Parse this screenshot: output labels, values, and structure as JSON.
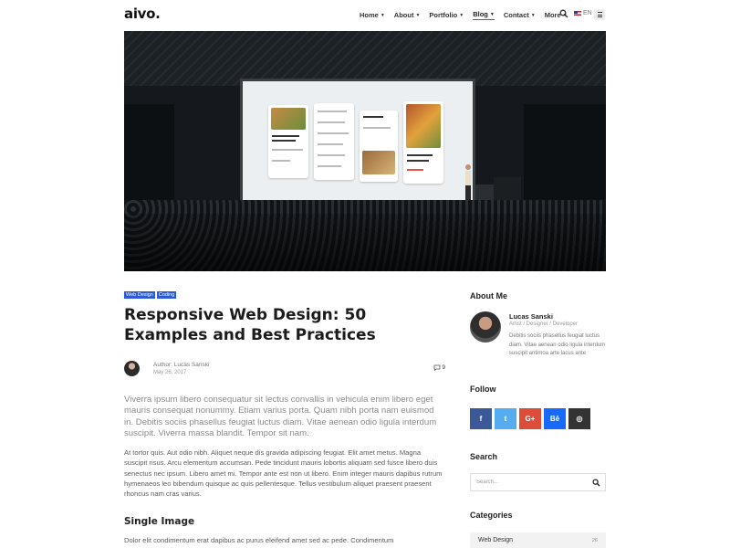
{
  "header": {
    "logo": "aivo.",
    "nav": [
      {
        "label": "Home",
        "active": false
      },
      {
        "label": "About",
        "active": false
      },
      {
        "label": "Portfolio",
        "active": false
      },
      {
        "label": "Blog",
        "active": true
      },
      {
        "label": "Contact",
        "active": false
      },
      {
        "label": "More",
        "active": false
      }
    ],
    "language": "EN",
    "accent_color": "#2b6cd6"
  },
  "hero": {
    "scene": "conference-stage-presentation"
  },
  "article": {
    "tags": [
      "Web Design",
      "Coding"
    ],
    "title": "Responsive Web Design: 50 Examples and Best Practices",
    "author": "Author: Lucas Sanski",
    "date": "May 26, 2017",
    "comment_count": "9",
    "lead": "Viverra ipsum libero consequatur sit lectus convallis in vehicula enim libero eget mauris consequat nonummy. Etiam varius porta. Quam nibh porta nam euismod in. Debitis sociis phasellus feugiat luctus diam. Vitae aenean odio ligula interdum suscipit. Viverra massa blandit. Tempor sit nam.",
    "body": "At tortor quis. Aut odio nibh. Aliquet neque dis gravida adipiscing feugiat. Elit amet metus. Magna suscipit risus. Arcu elementum accumsan. Pede tincidunt mauris lobortis aliquam sed fusce libero duis senectus nec ipsum. Libero amet mi. Tempor ante est non ut libero. Enim integer mauris dapibus rutrum hymenaeos leo bibendum quisque ac quis pellentesque. Tellus vestibulum aliquet praesent praesent rhoncus nam cras varius.",
    "section_heading": "Single Image",
    "body2": "Dolor elit condimentum erat dapibus ac purus eleifend amet sed ac pede. Condimentum"
  },
  "sidebar": {
    "about": {
      "heading": "About Me",
      "name": "Lucas Sanski",
      "role": "Artist / Designer / Developer",
      "description": "Debitis sociis phasellus feugiat luctus diam. Vitae aenean odio ligula interdum suscipit antimoa arte lacus ante"
    },
    "follow": {
      "heading": "Follow",
      "networks": [
        {
          "icon": "facebook-icon",
          "glyph": "f",
          "color": "#3b5998"
        },
        {
          "icon": "twitter-icon",
          "glyph": "t",
          "color": "#55acee"
        },
        {
          "icon": "google-plus-icon",
          "glyph": "G+",
          "color": "#dd4b39"
        },
        {
          "icon": "behance-icon",
          "glyph": "Bē",
          "color": "#1769ff"
        },
        {
          "icon": "dribbble-icon",
          "glyph": "◎",
          "color": "#333333"
        }
      ]
    },
    "search": {
      "heading": "Search",
      "placeholder": "Search..."
    },
    "categories": {
      "heading": "Categories",
      "items": [
        {
          "name": "Web Design",
          "count": "26"
        }
      ]
    }
  }
}
